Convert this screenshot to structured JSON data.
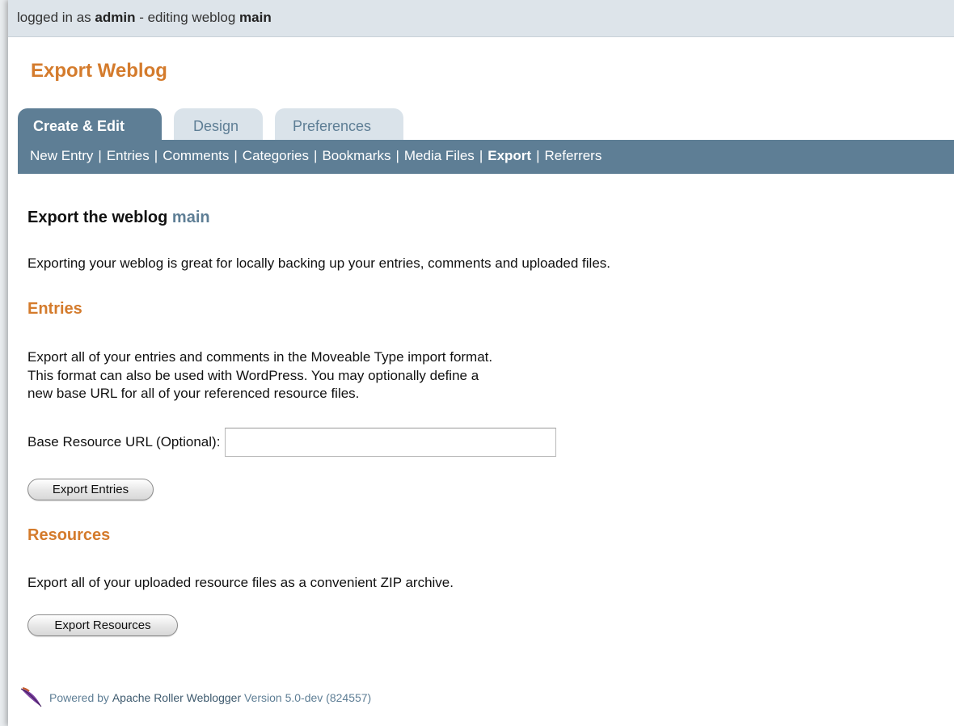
{
  "status": {
    "prefix": "logged in as",
    "user": "admin",
    "middle": "- editing weblog",
    "weblog": "main"
  },
  "page_title": "Export Weblog",
  "tabs": [
    {
      "label": "Create & Edit",
      "active": true
    },
    {
      "label": "Design",
      "active": false
    },
    {
      "label": "Preferences",
      "active": false
    }
  ],
  "subnav": [
    {
      "label": "New Entry"
    },
    {
      "label": "Entries"
    },
    {
      "label": "Comments"
    },
    {
      "label": "Categories"
    },
    {
      "label": "Bookmarks"
    },
    {
      "label": "Media Files"
    },
    {
      "label": "Export",
      "current": true
    },
    {
      "label": "Referrers"
    }
  ],
  "subnav_separator": "|",
  "heading": {
    "prefix": "Export the weblog",
    "blogname": "main"
  },
  "intro": "Exporting your weblog is great for locally backing up your entries, comments and uploaded files.",
  "entries": {
    "title": "Entries",
    "desc_lines": [
      "Export all of your entries and comments in the Moveable Type import format.",
      "This format can also be used with WordPress. You may optionally define a",
      "new base URL for all of your referenced resource files."
    ],
    "url_label": "Base Resource URL (Optional):",
    "url_value": "",
    "button": "Export Entries"
  },
  "resources": {
    "title": "Resources",
    "desc": "Export all of your uploaded resource files as a convenient ZIP archive.",
    "button": "Export Resources"
  },
  "footer": {
    "powered": "Powered by",
    "product": "Apache Roller Weblogger",
    "version": "Version 5.0-dev (824557)",
    "icon": "feather-icon",
    "feather_color": "#7b3fa0"
  }
}
